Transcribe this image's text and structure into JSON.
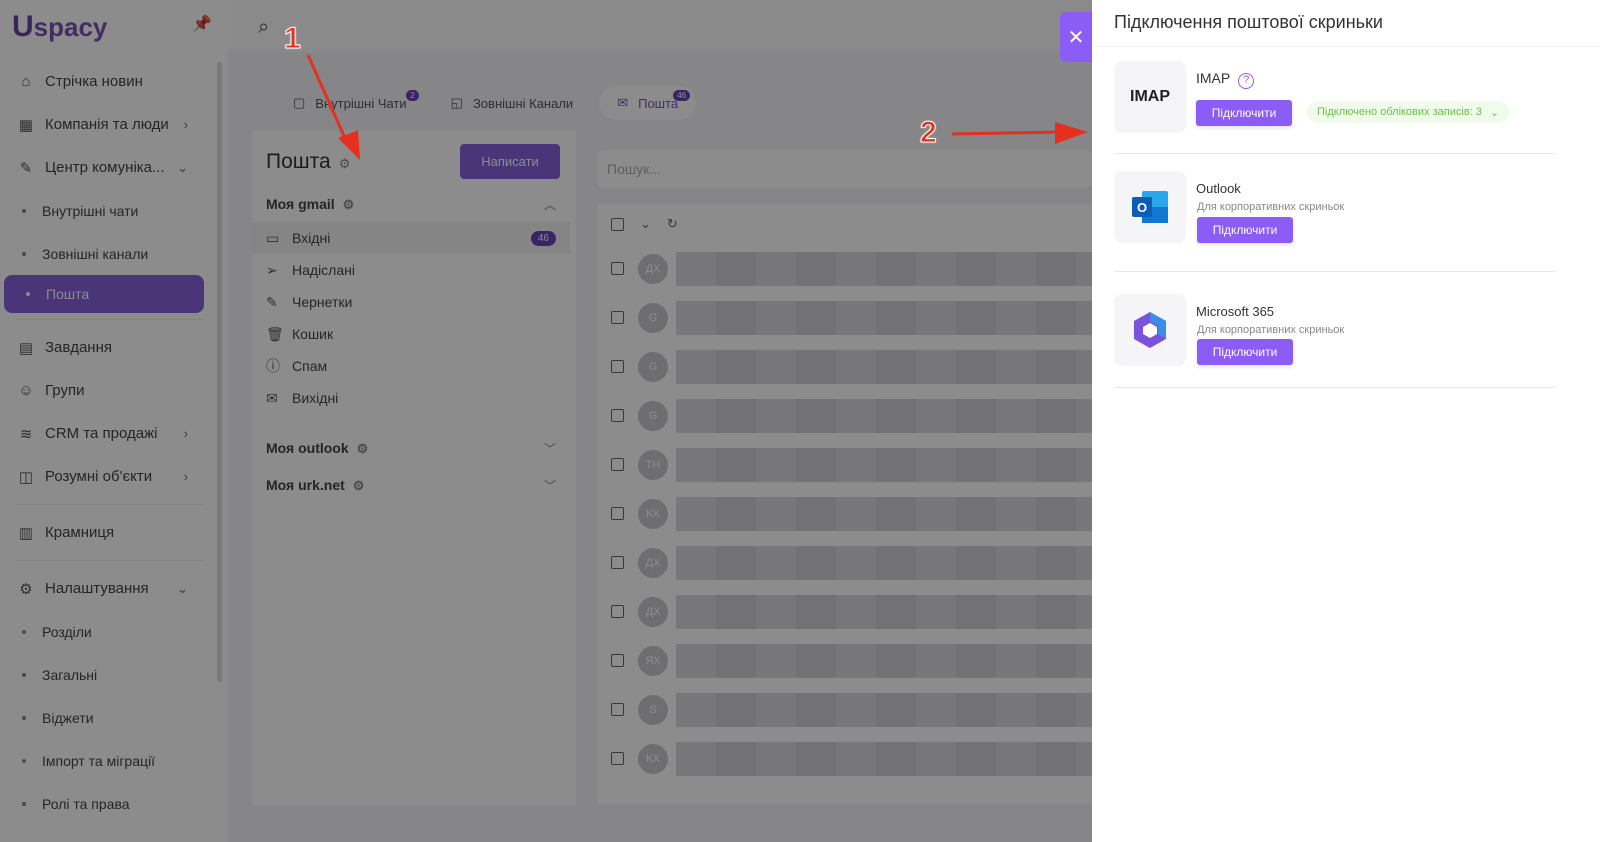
{
  "app": {
    "logo": "Uspacy"
  },
  "sidebar": {
    "items": [
      {
        "label": "Стрічка новин",
        "icon": "home-icon",
        "type": "main"
      },
      {
        "label": "Компанія та люди",
        "icon": "building-icon",
        "type": "main",
        "chevron": "›"
      },
      {
        "label": "Центр комуніка...",
        "icon": "communication-icon",
        "type": "main",
        "chevron": "⌄"
      },
      {
        "label": "Внутрішні чати",
        "type": "sub"
      },
      {
        "label": "Зовнішні канали",
        "type": "sub"
      },
      {
        "label": "Пошта",
        "type": "sub",
        "active": true
      },
      {
        "label": "Завдання",
        "icon": "calendar-icon",
        "type": "main"
      },
      {
        "label": "Групи",
        "icon": "users-icon",
        "type": "main"
      },
      {
        "label": "CRM та продажі",
        "icon": "database-icon",
        "type": "main",
        "chevron": "›"
      },
      {
        "label": "Розумні об'єкти",
        "icon": "smart-object-icon",
        "type": "main",
        "chevron": "›"
      },
      {
        "label": "Крамниця",
        "icon": "store-icon",
        "type": "main"
      },
      {
        "label": "Налаштування",
        "icon": "gear-icon",
        "type": "main",
        "chevron": "⌄"
      },
      {
        "label": "Розділи",
        "type": "sub"
      },
      {
        "label": "Загальні",
        "type": "sub"
      },
      {
        "label": "Віджети",
        "type": "sub"
      },
      {
        "label": "Імпорт та міграції",
        "type": "sub"
      },
      {
        "label": "Ролі та права",
        "type": "sub"
      }
    ]
  },
  "tabs": [
    {
      "label": "Внутрішні Чати",
      "badge": "2"
    },
    {
      "label": "Зовнішні Канали"
    },
    {
      "label": "Пошта",
      "badge": "46",
      "active": true
    }
  ],
  "mail": {
    "title": "Пошта",
    "write": "Написати",
    "search_placeholder": "Пошук...",
    "accounts": [
      {
        "name": "Моя gmail",
        "expanded": true
      },
      {
        "name": "Моя outlook"
      },
      {
        "name": "Моя urk.net"
      }
    ],
    "folders": [
      {
        "label": "Вхідні",
        "icon": "inbox-icon",
        "count": "46"
      },
      {
        "label": "Надіслані",
        "icon": "send-icon"
      },
      {
        "label": "Чернетки",
        "icon": "edit-icon"
      },
      {
        "label": "Кошик",
        "icon": "trash-icon"
      },
      {
        "label": "Спам",
        "icon": "alert-icon"
      },
      {
        "label": "Вихідні",
        "icon": "outbox-icon"
      }
    ],
    "rows": [
      "ДХ",
      "G",
      "G",
      "G",
      "ТН",
      "КХ",
      "ДХ",
      "ДХ",
      "ЯХ",
      "S",
      "КХ"
    ]
  },
  "drawer": {
    "title": "Підключення поштової скриньки",
    "providers": [
      {
        "name": "IMAP",
        "logo": "IMAP",
        "button": "Підключити",
        "connected": "Підключено облікових записів: 3"
      },
      {
        "name": "Outlook",
        "desc": "Для корпоративних скриньок",
        "button": "Підключити"
      },
      {
        "name": "Microsoft 365",
        "desc": "Для корпоративних скриньок",
        "button": "Підключити"
      }
    ]
  },
  "annotations": [
    "1",
    "2"
  ],
  "colors": {
    "accent": "#8b5cf6",
    "connected": "#6cc048",
    "annotation": "#e53020"
  }
}
